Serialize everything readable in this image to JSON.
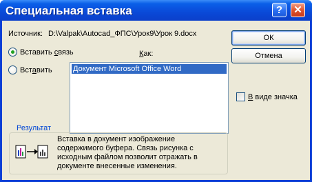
{
  "window": {
    "title": "Специальная вставка",
    "help_icon": "?",
    "close_icon": "✕"
  },
  "source": {
    "label": "Источник:",
    "path": "D:\\Valpak\\Autocad_ФПС\\Урок9\\Урок 9.docx"
  },
  "options": {
    "paste_link": {
      "before": "Вставить ",
      "accel": "с",
      "after": "вязь",
      "selected": true
    },
    "paste": {
      "before": "Вст",
      "accel": "а",
      "after": "вить",
      "selected": false
    }
  },
  "as_label": {
    "accel": "К",
    "after": "ак:"
  },
  "as_list": {
    "items": [
      "Документ Microsoft Office Word"
    ],
    "selected_index": 0
  },
  "buttons": {
    "ok": "ОК",
    "cancel": "Отмена"
  },
  "display_as_icon": {
    "accel": "В",
    "after": " виде значка",
    "checked": false
  },
  "result": {
    "label": "Результат",
    "text": "Вставка в документ изображение содержимого буфера. Связь рисунка с исходным файлом позволит отражать в документе внесенные изменения."
  },
  "colors": {
    "titlebar": "#0a49d8",
    "dialog_bg": "#ece9d8",
    "selection": "#316ac5",
    "group_label": "#0046d5",
    "radio_dot": "#21a121"
  }
}
